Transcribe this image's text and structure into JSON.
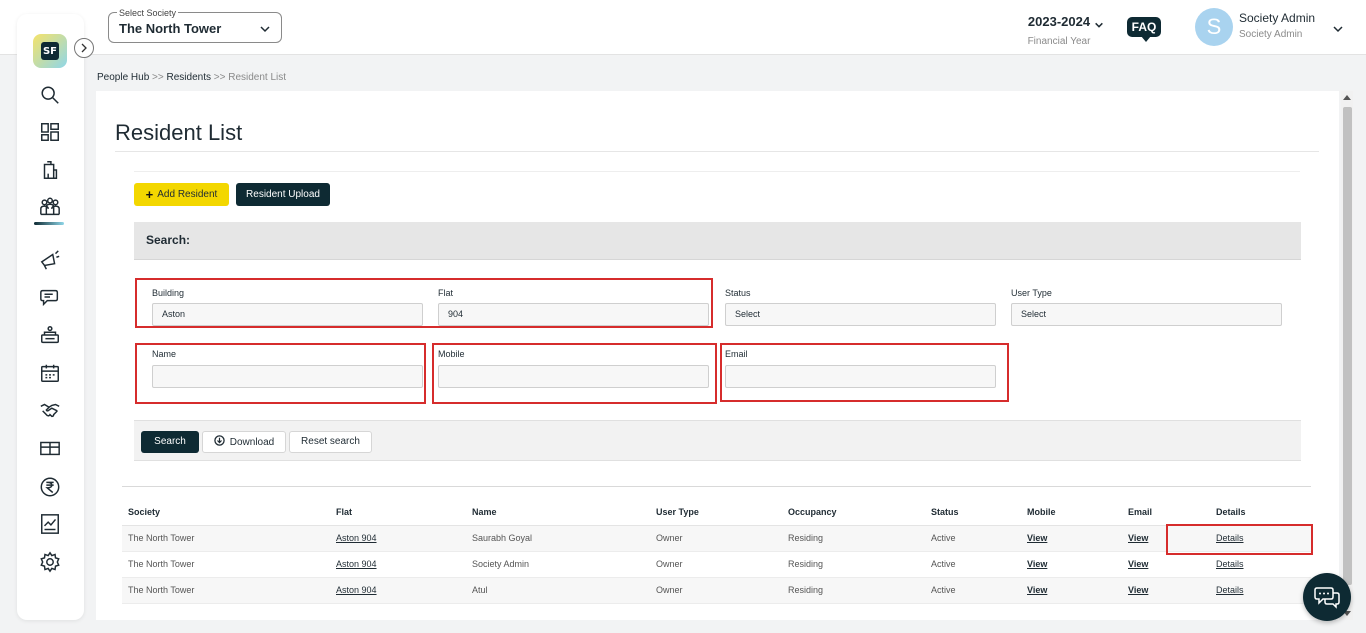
{
  "header": {
    "society_label": "Select Society",
    "society_value": "The North Tower",
    "financial_year": "2023-2024",
    "financial_year_label": "Financial Year",
    "faq_label": "FAQ",
    "avatar_letter": "S",
    "user_name": "Society Admin",
    "user_role": "Society Admin"
  },
  "sidebar": {
    "logo_text": "SF",
    "icons": [
      "search-icon",
      "dashboard-icon",
      "building-icon",
      "people-icon",
      "announcement-icon",
      "chat-icon",
      "amenities-icon",
      "calendar-icon",
      "handshake-icon",
      "parcel-icon",
      "rupee-icon",
      "report-icon",
      "settings-icon"
    ],
    "active": "people-icon"
  },
  "breadcrumb": {
    "items": [
      "People Hub",
      "Residents",
      "Resident List"
    ],
    "separator": ">>"
  },
  "page": {
    "title": "Resident List",
    "add_button": "Add Resident",
    "upload_button": "Resident Upload",
    "search_heading": "Search:"
  },
  "filters": {
    "building": {
      "label": "Building",
      "value": "Aston"
    },
    "flat": {
      "label": "Flat",
      "value": "904"
    },
    "status": {
      "label": "Status",
      "value": "Select"
    },
    "user_type": {
      "label": "User Type",
      "value": "Select"
    },
    "name": {
      "label": "Name",
      "value": ""
    },
    "mobile": {
      "label": "Mobile",
      "value": ""
    },
    "email": {
      "label": "Email",
      "value": ""
    }
  },
  "actions": {
    "search": "Search",
    "download": "Download",
    "reset": "Reset search"
  },
  "table": {
    "columns": [
      "Society",
      "Flat",
      "Name",
      "User Type",
      "Occupancy",
      "Status",
      "Mobile",
      "Email",
      "Details"
    ],
    "rows": [
      {
        "society": "The North Tower",
        "flat": "Aston 904",
        "name": "Saurabh Goyal",
        "user_type": "Owner",
        "occupancy": "Residing",
        "status": "Active",
        "mobile": "View",
        "email": "View",
        "details": "Details"
      },
      {
        "society": "The North Tower",
        "flat": "Aston 904",
        "name": "Society Admin",
        "user_type": "Owner",
        "occupancy": "Residing",
        "status": "Active",
        "mobile": "View",
        "email": "View",
        "details": "Details"
      },
      {
        "society": "The North Tower",
        "flat": "Aston 904",
        "name": "Atul",
        "user_type": "Owner",
        "occupancy": "Residing",
        "status": "Active",
        "mobile": "View",
        "email": "View",
        "details": "Details"
      }
    ]
  },
  "colors": {
    "primary": "#0e2a33",
    "accent": "#f3d700",
    "highlight": "#d62c2c"
  }
}
